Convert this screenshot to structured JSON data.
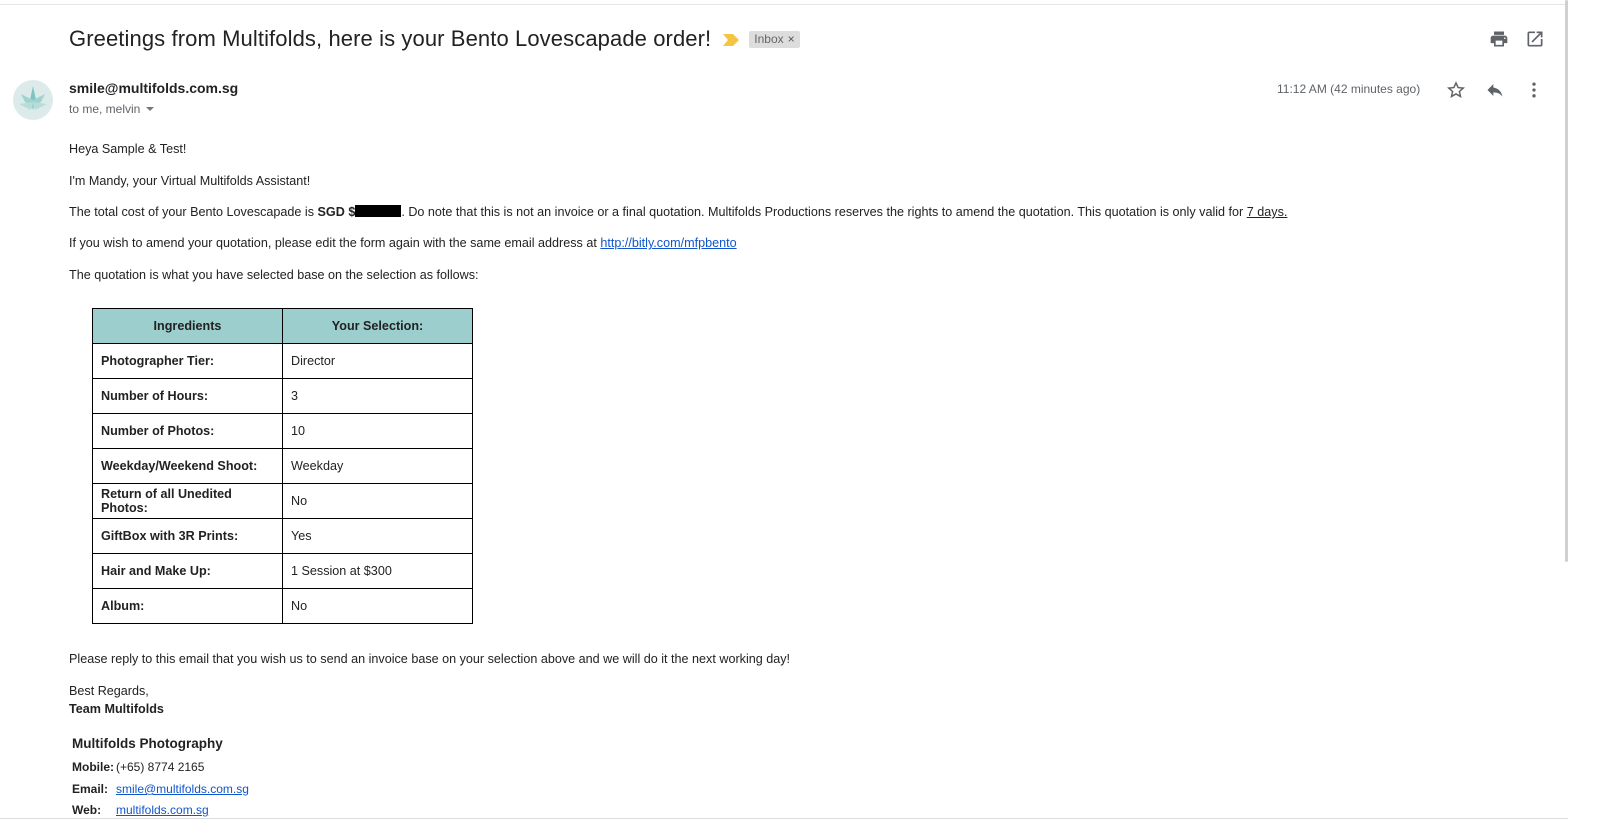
{
  "email": {
    "subject": "Greetings from Multifolds, here is your Bento Lovescapade order!",
    "label_chip": "Inbox",
    "label_chip_close": "×",
    "sender": "smile@multifolds.com.sg",
    "recipients": "to me, melvin",
    "timestamp": "11:12 AM (42 minutes ago)"
  },
  "toolbar_icons": [
    "print-icon",
    "open-in-new-window-icon",
    "star-icon",
    "reply-icon",
    "more-vertical-icon"
  ],
  "body": {
    "greeting": "Heya Sample & Test!",
    "intro": "I'm Mandy, your Virtual Multifolds Assistant!",
    "cost_prefix": "The total cost of your Bento Lovescapade is ",
    "cost_bold": "SGD $",
    "cost_suffix": ". Do note that this is not an invoice or a final quotation. Multifolds Productions reserves the rights to amend the quotation. This quotation is only valid for ",
    "validity": "7 days.",
    "amend_prefix": "If you wish to amend your quotation, please edit the form again with the same email address at ",
    "amend_link": "http://bitly.com/mfpbento ",
    "selection_intro": "The quotation is what you have selected base on the selection as follows:",
    "closing_request": "Please reply to this email that you wish us to send an invoice base on your selection above and we will do it the next working day!",
    "regards": "Best Regards,",
    "team": "Team Multifolds"
  },
  "table": {
    "headers": [
      "Ingredients",
      "Your Selection:"
    ],
    "rows": [
      {
        "label": "Photographer Tier:",
        "value": "Director"
      },
      {
        "label": "Number of Hours:",
        "value": "3"
      },
      {
        "label": "Number of Photos:",
        "value": "10"
      },
      {
        "label": "Weekday/Weekend Shoot:",
        "value": "Weekday"
      },
      {
        "label": "Return of all Unedited Photos:",
        "value": "No"
      },
      {
        "label": "GiftBox with 3R Prints:",
        "value": "Yes"
      },
      {
        "label": "Hair and Make Up:",
        "value": "1 Session at $300"
      },
      {
        "label": "Album:",
        "value": "No"
      }
    ]
  },
  "signature": {
    "company": "Multifolds Photography",
    "mobile_label": "Mobile:",
    "mobile": "(+65) 8774 2165",
    "email_label": "Email:",
    "email": "smile@multifolds.com.sg",
    "web_label": "Web:",
    "web": "multifolds.com.sg"
  },
  "colors": {
    "table_header_bg": "#9ccecd",
    "link": "#1155cc",
    "importance_marker": "#f4c542",
    "chip_bg": "#dddddd"
  }
}
